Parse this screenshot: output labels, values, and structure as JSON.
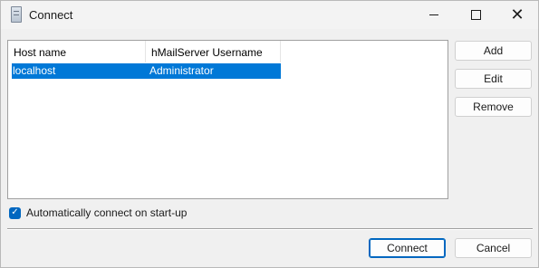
{
  "window": {
    "title": "Connect",
    "icons": {
      "app": "server-icon",
      "minimize": "minimize-icon",
      "maximize": "maximize-icon",
      "close": "close-icon"
    },
    "close_glyph": "✕"
  },
  "connections": {
    "columns": [
      "Host name",
      "hMailServer Username"
    ],
    "rows": [
      {
        "host": "localhost",
        "username": "Administrator",
        "selected": true
      }
    ],
    "selection_color": "#0078d7"
  },
  "buttons": {
    "add": "Add",
    "edit": "Edit",
    "remove": "Remove",
    "connect": "Connect",
    "cancel": "Cancel"
  },
  "auto_connect": {
    "label": "Automatically connect on start-up",
    "checked": true,
    "check_glyph": "✓"
  },
  "accent_color": "#0067c0"
}
